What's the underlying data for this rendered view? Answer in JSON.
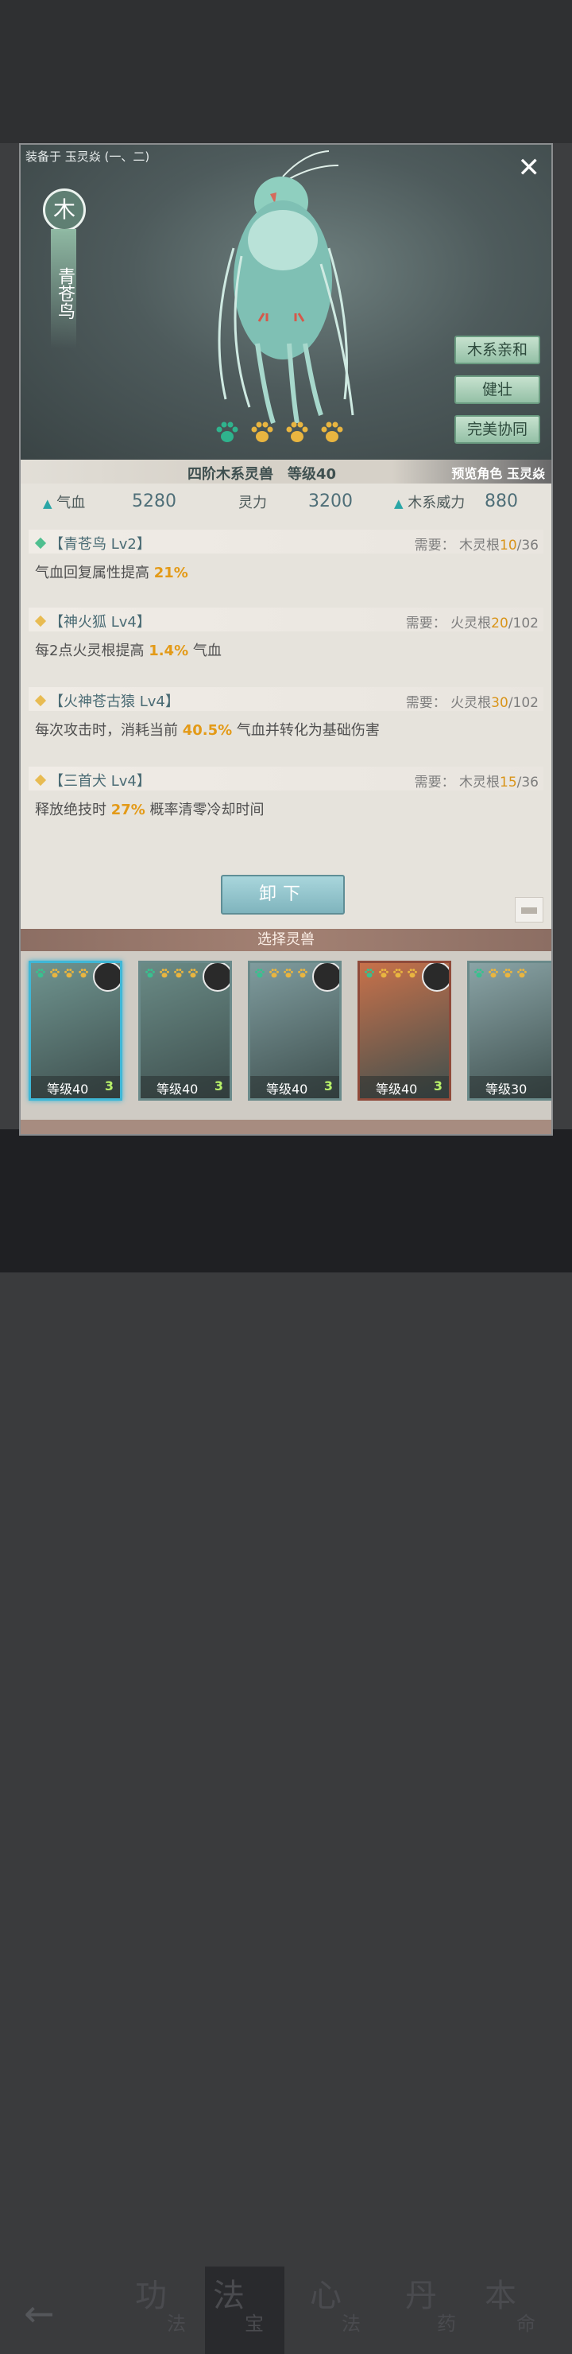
{
  "equipped_label": "装备于 玉灵焱 (一、二)",
  "element": "木",
  "beast_name": "青苍鸟",
  "traits": [
    "木系亲和",
    "健壮",
    "完美协同"
  ],
  "paw_colors": [
    "#2fb38d",
    "#e9b540",
    "#e9b540",
    "#e9b540"
  ],
  "info": {
    "center": "四阶木系灵兽　等级40",
    "right": "预览角色 玉灵焱"
  },
  "stats": {
    "hp_label": "气血",
    "hp_value": "5280",
    "sp_label": "灵力",
    "sp_value": "3200",
    "power_label": "木系威力",
    "power_value": "880"
  },
  "skills": [
    {
      "title": "【青苍鸟 Lv2】",
      "diamond": "#4fbf8f",
      "req_prefix": "需要：",
      "req_root": "木灵根",
      "req_have": "10",
      "req_need": "/36",
      "desc_pre": "气血回复属性提高 ",
      "desc_hl": "21%",
      "desc_post": ""
    },
    {
      "title": "【神火狐 Lv4】",
      "diamond": "#e8bb52",
      "req_prefix": "需要：",
      "req_root": "火灵根",
      "req_have": "20",
      "req_need": "/102",
      "desc_pre": "每2点火灵根提高 ",
      "desc_hl": "1.4%",
      "desc_post": " 气血"
    },
    {
      "title": "【火神苍古猿 Lv4】",
      "diamond": "#e8bb52",
      "req_prefix": "需要：",
      "req_root": "火灵根",
      "req_have": "30",
      "req_need": "/102",
      "desc_pre": "每次攻击时，消耗当前 ",
      "desc_hl": "40.5%",
      "desc_post": " 气血并转化为基础伤害"
    },
    {
      "title": "【三首犬 Lv4】",
      "diamond": "#e8bb52",
      "req_prefix": "需要：",
      "req_root": "木灵根",
      "req_have": "15",
      "req_need": "/36",
      "desc_pre": "释放绝技时 ",
      "desc_hl": "27%",
      "desc_post": " 概率清零冷却时间"
    }
  ],
  "unequip_label": "卸下",
  "select_title": "选择灵兽",
  "roster": [
    {
      "level": "等级40",
      "count": "3",
      "bg": "#6f948f"
    },
    {
      "level": "等级40",
      "count": "3",
      "bg": "#6a8b86"
    },
    {
      "level": "等级40",
      "count": "3",
      "bg": "#7f9c9e"
    },
    {
      "level": "等级40",
      "count": "3",
      "bg": "#c8714a"
    },
    {
      "level": "等级30",
      "count": "",
      "bg": "#8aa4a6"
    }
  ],
  "nav": [
    {
      "big": "功",
      "small": "法"
    },
    {
      "big": "法",
      "small": "宝"
    },
    {
      "big": "心",
      "small": "法"
    },
    {
      "big": "丹",
      "small": "药"
    },
    {
      "big": "本",
      "small": "命"
    }
  ]
}
